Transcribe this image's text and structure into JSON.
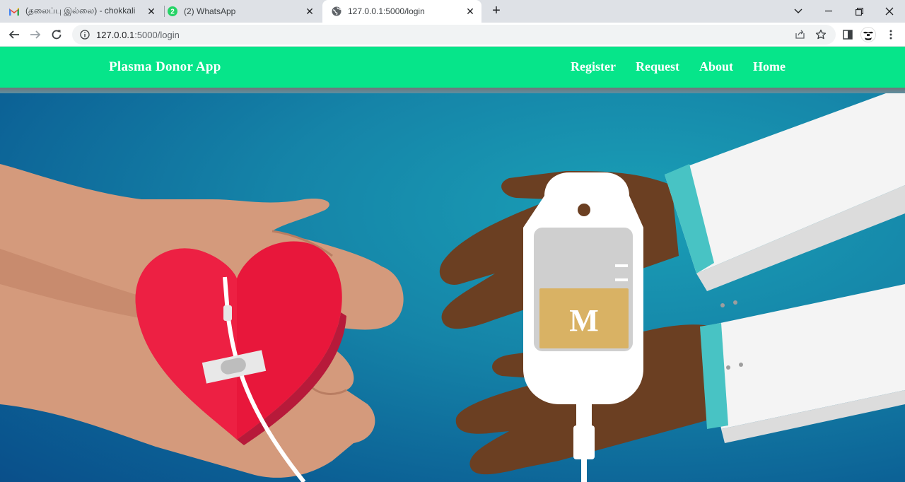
{
  "browser": {
    "tabs": [
      {
        "title": "(தலைப்பு இல்லை) - chokkali",
        "favicon": "gmail-icon"
      },
      {
        "title": "(2) WhatsApp",
        "favicon": "whatsapp-icon",
        "badge": "2"
      },
      {
        "title": "127.0.0.1:5000/login",
        "favicon": "globe-icon",
        "active": true
      }
    ],
    "url_host": "127.0.0.1",
    "url_rest": ":5000/login",
    "colors": {
      "tabstrip": "#dee1e6",
      "omnibox": "#f1f3f4"
    }
  },
  "navbar": {
    "brand": "Plasma Donor App",
    "links": [
      "Register",
      "Request",
      "About",
      "Home"
    ],
    "color": "#06e58a"
  },
  "hero": {
    "bag_letter": "M",
    "colors": {
      "heart": "#e8173b",
      "background": "#1584a8",
      "plasma": "#d9b264"
    }
  }
}
